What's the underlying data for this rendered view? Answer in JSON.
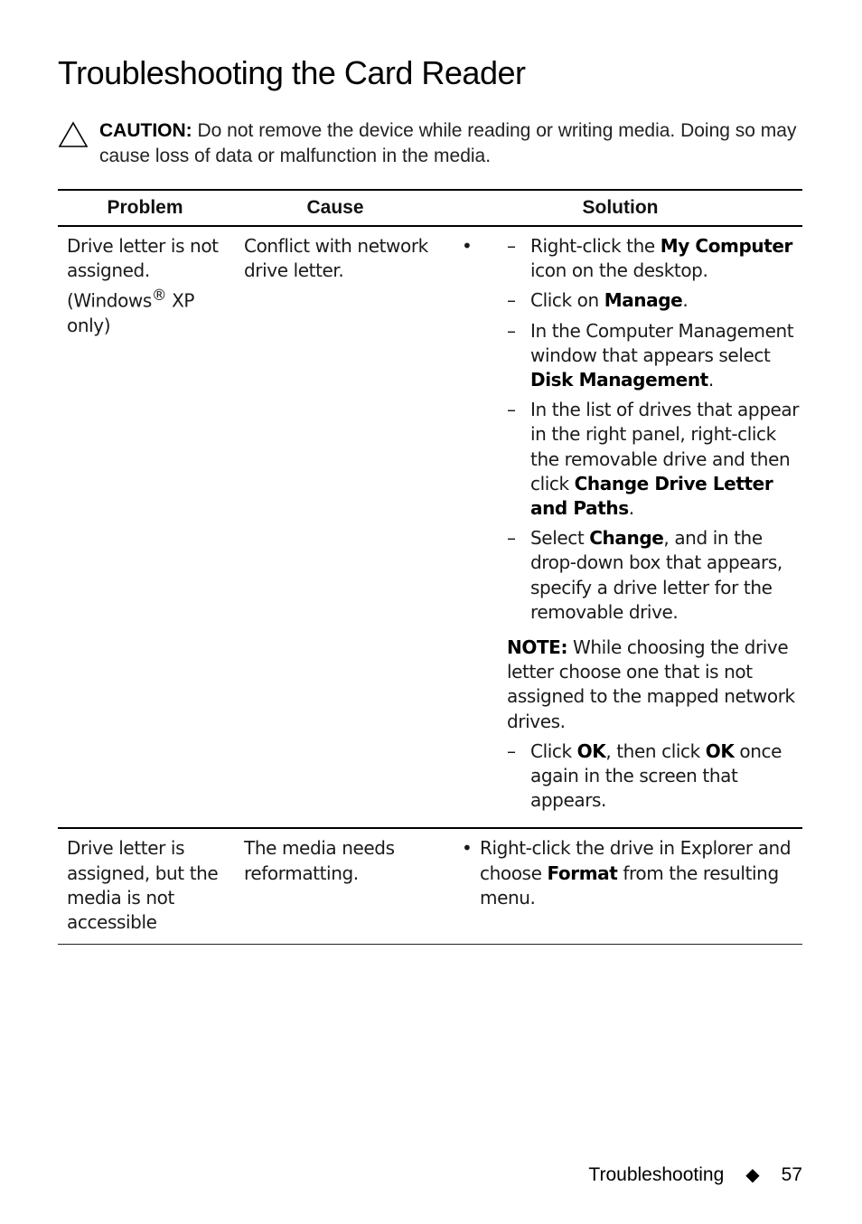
{
  "page": {
    "title": "Troubleshooting the Card Reader",
    "caution": {
      "icon": "caution-triangle-icon",
      "label": "CAUTION:",
      "text": " Do not remove the device while reading or writing media. Doing so may cause loss of data or malfunction in the media."
    },
    "table": {
      "headers": [
        "Problem",
        "Cause",
        "Solution"
      ],
      "rows": [
        {
          "problem_a": "Drive letter is not assigned. (Windows",
          "problem_reg": "®",
          "problem_b": " XP only)",
          "cause": "Conflict with network drive letter.",
          "bullet": "•",
          "steps": [
            {
              "pre": "Right-click the ",
              "bold": "My Computer",
              "post": " icon on the desktop."
            },
            {
              "pre": "Click on ",
              "bold": "Manage",
              "post": "."
            },
            {
              "pre": "In the Computer Management window that appears select ",
              "bold": "Disk Management",
              "post": "."
            },
            {
              "pre": "In the list of drives that appear in the right panel, right-click the removable drive and then click ",
              "bold": "Change Drive Letter and Paths",
              "post": "."
            },
            {
              "pre": "Select ",
              "bold": "Change",
              "post": ", and in the drop-down box that appears, specify a drive letter for the removable drive."
            }
          ],
          "note": {
            "label": "NOTE:",
            "text": " While choosing the drive letter choose one that is not assigned to the mapped network drives."
          },
          "final_step": {
            "pre": "Click ",
            "bold1": "OK",
            "mid": ", then click ",
            "bold2": "OK",
            "post": " once again in the screen that appears."
          },
          "dash": "–"
        },
        {
          "problem": "Drive letter is assigned, but the media is not accessible",
          "cause": "The media needs reformatting.",
          "bullet": "•",
          "solution": {
            "pre": "Right-click the drive in Explorer and choose ",
            "bold": "Format",
            "post": " from the resulting menu."
          }
        }
      ]
    },
    "footer": {
      "section": "Troubleshooting",
      "separator": "◆",
      "page_number": "57"
    }
  }
}
